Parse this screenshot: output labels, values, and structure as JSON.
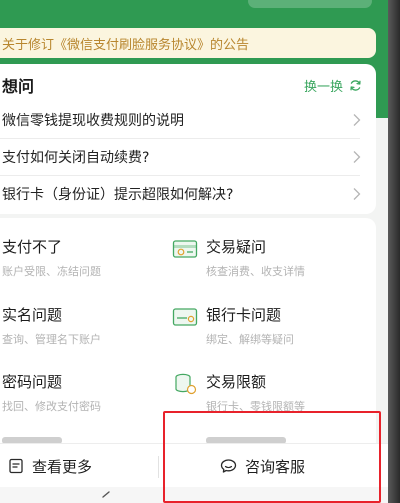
{
  "notice": {
    "text": "关于修订《微信支付刷脸服务协议》的公告"
  },
  "faq": {
    "title": "想问",
    "refresh_label": "换一换",
    "items": [
      {
        "label": "微信零钱提现收费规则的说明"
      },
      {
        "label": "支付如何关闭自动续费?"
      },
      {
        "label": "银行卡（身份证）提示超限如何解决?"
      }
    ]
  },
  "categories": [
    {
      "title": "支付不了",
      "subtitle": "账户受限、冻结问题",
      "icon": ""
    },
    {
      "title": "交易疑问",
      "subtitle": "核查消费、收支详情",
      "icon": "receipt-icon"
    },
    {
      "title": "实名问题",
      "subtitle": "查询、管理名下账户",
      "icon": ""
    },
    {
      "title": "银行卡问题",
      "subtitle": "绑定、解绑等疑问",
      "icon": "bank-card-icon"
    },
    {
      "title": "密码问题",
      "subtitle": "找回、修改支付密码",
      "icon": ""
    },
    {
      "title": "交易限额",
      "subtitle": "银行卡、零钱限额等",
      "icon": "coins-icon"
    },
    {
      "title": "",
      "subtitle": "",
      "partial": true
    },
    {
      "title": "",
      "subtitle": "",
      "partial": true
    }
  ],
  "bottom_bar": {
    "more_label": "查看更多",
    "service_label": "咨询客服"
  },
  "colors": {
    "brand_green": "#2f9a52",
    "accent_green": "#3aa65f",
    "notice_text": "#b8862e",
    "highlight_red": "#e8222b"
  }
}
